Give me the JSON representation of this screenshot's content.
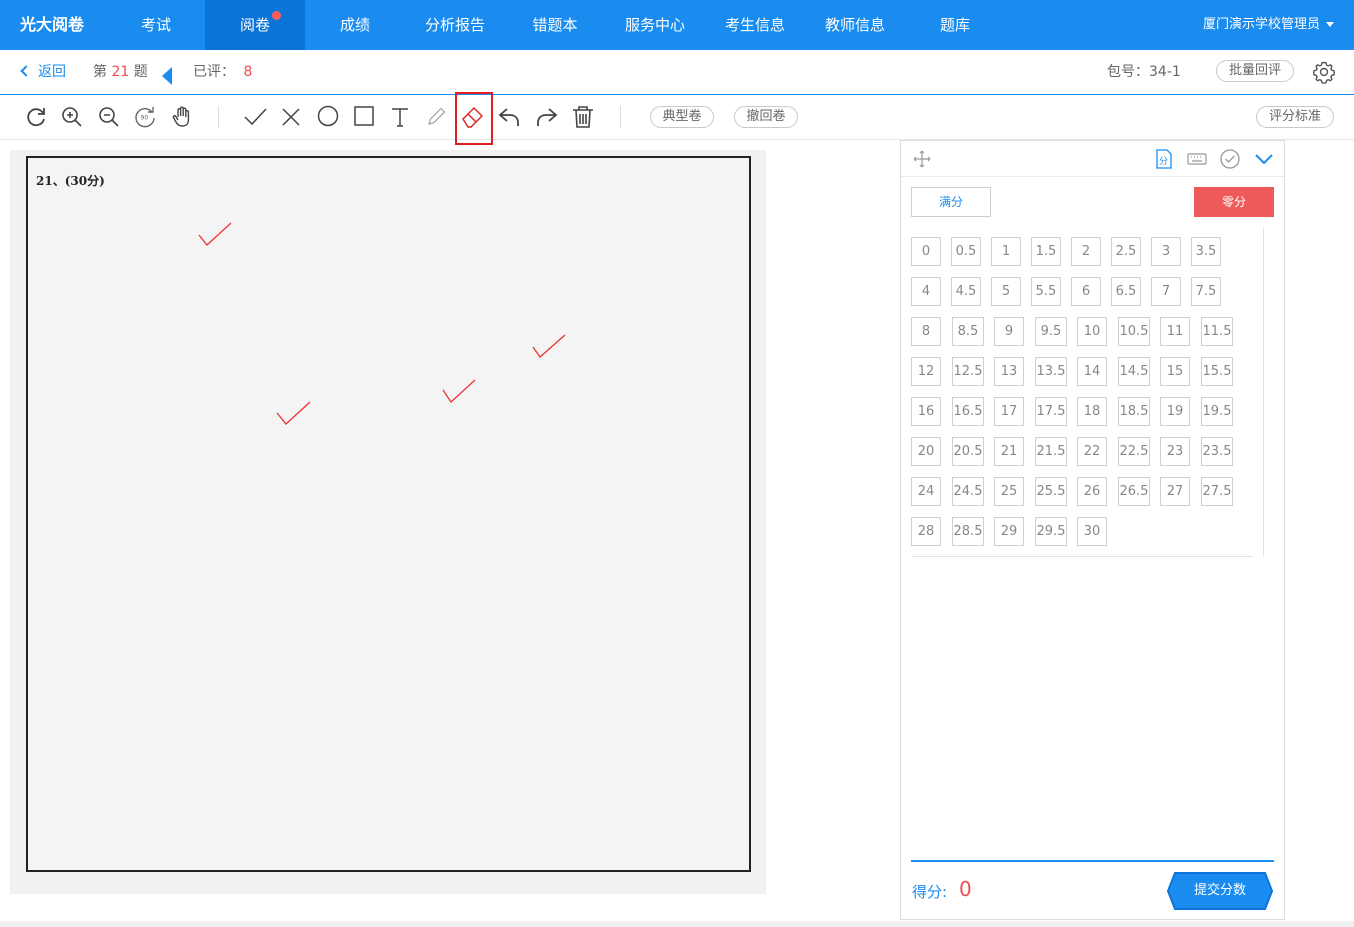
{
  "app": {
    "logo": "光大阅卷",
    "user": "厦门演示学校管理员"
  },
  "nav": [
    {
      "label": "考试",
      "active": false
    },
    {
      "label": "阅卷",
      "active": true,
      "badge": true
    },
    {
      "label": "成绩",
      "active": false
    },
    {
      "label": "分析报告",
      "active": false
    },
    {
      "label": "错题本",
      "active": false
    },
    {
      "label": "服务中心",
      "active": false
    },
    {
      "label": "考生信息",
      "active": false
    },
    {
      "label": "教师信息",
      "active": false
    },
    {
      "label": "题库",
      "active": false
    }
  ],
  "subbar": {
    "back": "返回",
    "q_prefix": "第",
    "q_number": "21",
    "q_suffix": "题",
    "reviewed_label": "已评：",
    "reviewed_count": "8",
    "package_label": "包号：",
    "package_value": "34-1",
    "batch_review": "批量回评"
  },
  "toolbar": {
    "typical_paper": "典型卷",
    "return_paper": "撤回卷",
    "scoring_standard": "评分标准",
    "icons": [
      "rotate-icon",
      "zoom-in-icon",
      "zoom-out-icon",
      "rotate-90-icon",
      "hand-icon",
      "check-mark-icon",
      "cross-mark-icon",
      "circle-icon",
      "rectangle-icon",
      "text-icon",
      "pencil-icon",
      "eraser-icon",
      "undo-icon",
      "redo-icon",
      "delete-icon"
    ],
    "selected_tool": "eraser-icon"
  },
  "paper": {
    "question_label": "21、(30分)",
    "marks": [
      "check",
      "check",
      "check",
      "check"
    ]
  },
  "panel": {
    "full_score": "满分",
    "zero_score": "零分",
    "scores": [
      "0",
      "0.5",
      "1",
      "1.5",
      "2",
      "2.5",
      "3",
      "3.5",
      "4",
      "4.5",
      "5",
      "5.5",
      "6",
      "6.5",
      "7",
      "7.5",
      "8",
      "8.5",
      "9",
      "9.5",
      "10",
      "10.5",
      "11",
      "11.5",
      "12",
      "12.5",
      "13",
      "13.5",
      "14",
      "14.5",
      "15",
      "15.5",
      "16",
      "16.5",
      "17",
      "17.5",
      "18",
      "18.5",
      "19",
      "19.5",
      "20",
      "20.5",
      "21",
      "21.5",
      "22",
      "22.5",
      "23",
      "23.5",
      "24",
      "24.5",
      "25",
      "25.5",
      "26",
      "26.5",
      "27",
      "27.5",
      "28",
      "28.5",
      "29",
      "29.5",
      "30"
    ],
    "score_label": "得分:",
    "score_value": "0",
    "submit": "提交分数"
  },
  "colors": {
    "primary": "#1a8cf0",
    "danger": "#ee5a5a"
  }
}
